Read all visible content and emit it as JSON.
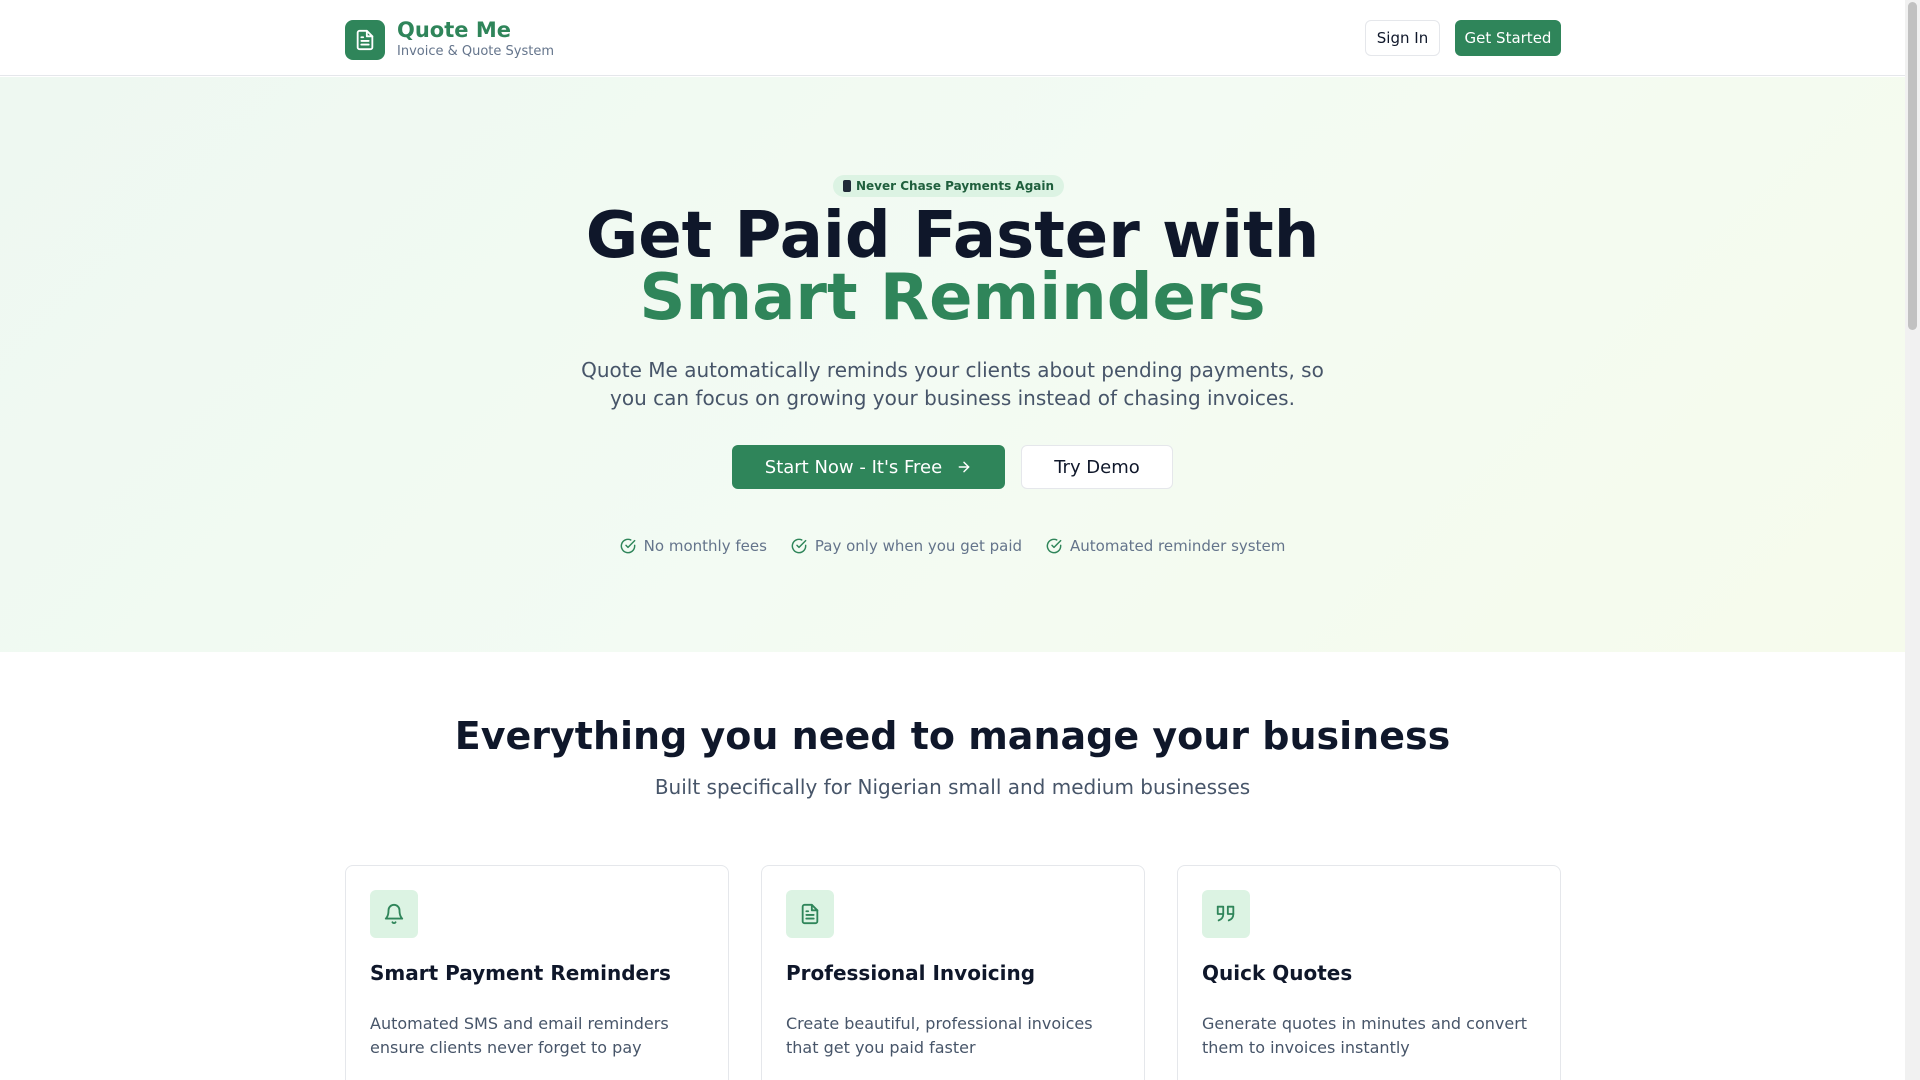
{
  "header": {
    "brand_name": "Quote Me",
    "brand_sub": "Invoice & Quote System",
    "sign_in": "Sign In",
    "get_started": "Get Started"
  },
  "hero": {
    "badge": "Never Chase Payments Again",
    "title_line1": "Get Paid Faster with",
    "title_line2": "Smart Reminders",
    "description": "Quote Me automatically reminds your clients about pending payments, so you can focus on growing your business instead of chasing invoices.",
    "cta_primary": "Start Now - It's Free",
    "cta_secondary": "Try Demo",
    "perks": [
      "No monthly fees",
      "Pay only when you get paid",
      "Automated reminder system"
    ]
  },
  "features": {
    "title": "Everything you need to manage your business",
    "subtitle": "Built specifically for Nigerian small and medium businesses",
    "cards": [
      {
        "title": "Smart Payment Reminders",
        "desc": "Automated SMS and email reminders ensure clients never forget to pay",
        "icon": "bell-icon"
      },
      {
        "title": "Professional Invoicing",
        "desc": "Create beautiful, professional invoices that get you paid faster",
        "icon": "document-icon"
      },
      {
        "title": "Quick Quotes",
        "desc": "Generate quotes in minutes and convert them to invoices instantly",
        "icon": "quote-icon"
      }
    ]
  },
  "colors": {
    "brand": "#2f855a",
    "brand_light": "#dcf3e3",
    "text_dark": "#0f172a",
    "text_muted": "#64748b"
  }
}
